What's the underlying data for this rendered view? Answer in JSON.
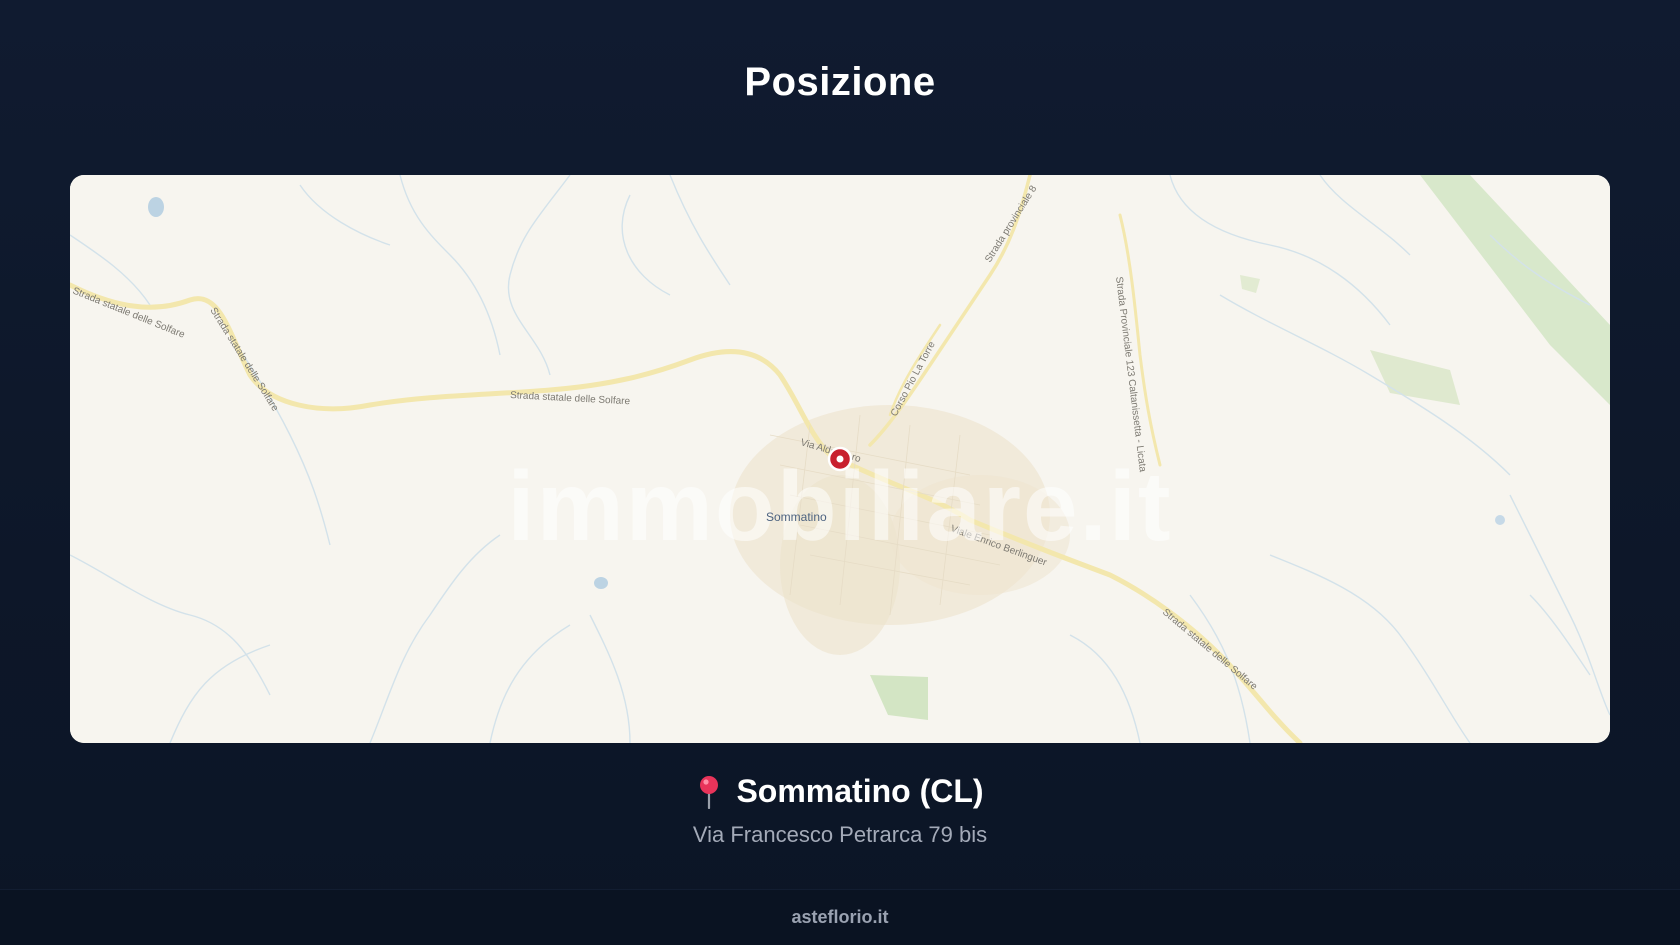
{
  "header": {
    "title": "Posizione"
  },
  "map": {
    "watermark": "immobiliare.it",
    "town_label": "Sommatino",
    "street_labels": {
      "ss_left_top": "Strada statale delle Solfare",
      "ss_left_vertical": "Strada statale delle Solfare",
      "ss_center": "Strada statale delle Solfare",
      "sp_top": "Strada provinciale 8",
      "sp_right": "Strada Provinciale 123 Caltanissetta - Licata",
      "corso": "Corso Pio La Torre",
      "via_moro": "Via Aldo Moro",
      "berlinguer": "Viale Enrico Berlinguer",
      "ss_right": "Strada statale delle Solfare"
    },
    "colors": {
      "land": "#f7f5ef",
      "water_lines": "#cfe0ea",
      "roads": "#f5e8b0",
      "urban": "#ece3cf",
      "park": "#cfe3c2",
      "marker": "#c8202e"
    }
  },
  "location": {
    "pin_icon": "round-pushpin-icon",
    "name": "Sommatino (CL)",
    "address": "Via Francesco Petrarca 79 bis"
  },
  "footer": {
    "site": "asteflorio.it"
  }
}
